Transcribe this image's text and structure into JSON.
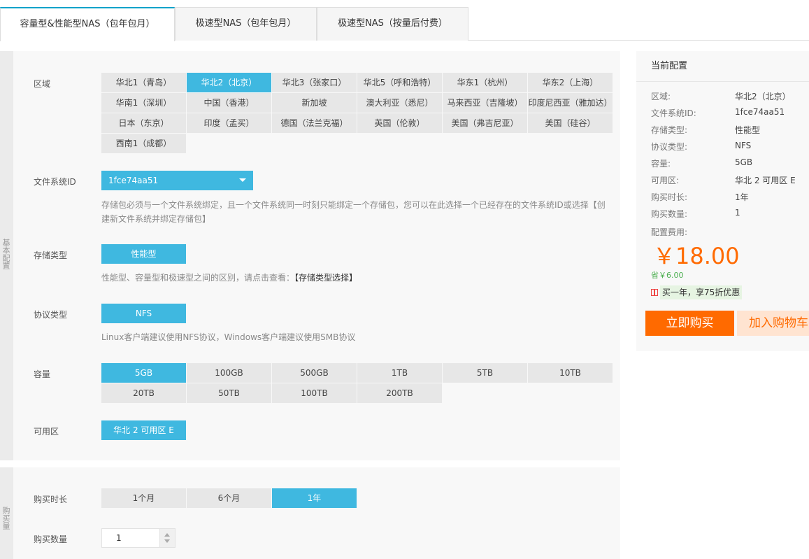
{
  "tabs": [
    {
      "label": "容量型&性能型NAS（包年包月）"
    },
    {
      "label": "极速型NAS（包年包月）"
    },
    {
      "label": "极速型NAS（按量后付费）"
    }
  ],
  "basic": {
    "section_label": "基本配置",
    "region": {
      "label": "区域",
      "selected": "华北2（北京）",
      "options": [
        "华北1（青岛）",
        "华北2（北京）",
        "华北3（张家口）",
        "华北5（呼和浩特）",
        "华东1（杭州）",
        "华东2（上海）",
        "华南1（深圳）",
        "中国（香港）",
        "新加坡",
        "澳大利亚（悉尼）",
        "马来西亚（吉隆坡）",
        "印度尼西亚（雅加达）",
        "日本（东京）",
        "印度（孟买）",
        "德国（法兰克福）",
        "英国（伦敦）",
        "美国（弗吉尼亚）",
        "美国（硅谷）",
        "西南1（成都）"
      ]
    },
    "filesystem": {
      "label": "文件系统ID",
      "value": "1fce74aa51",
      "hint_line1": "存储包必须与一个文件系统绑定，且一个文件系统同一时刻只能绑定一个存储包，您可以在此选择一个已经存在的文件系统ID或选择【创",
      "hint_line2": "建新文件系统并绑定存储包】"
    },
    "storage_type": {
      "label": "存储类型",
      "options": [
        "性能型"
      ],
      "hint": "性能型、容量型和极速型之间的区别，请点击查看：",
      "hint_link": "【存储类型选择】"
    },
    "protocol": {
      "label": "协议类型",
      "options": [
        "NFS"
      ],
      "hint": "Linux客户端建议使用NFS协议，Windows客户端建议使用SMB协议"
    },
    "capacity": {
      "label": "容量",
      "selected": "5GB",
      "options": [
        "5GB",
        "100GB",
        "500GB",
        "1TB",
        "5TB",
        "10TB",
        "20TB",
        "50TB",
        "100TB",
        "200TB"
      ]
    },
    "zone": {
      "label": "可用区",
      "options": [
        "华北 2 可用区 E"
      ]
    }
  },
  "purchase": {
    "section_label": "购买量",
    "duration": {
      "label": "购买时长",
      "selected": "1年",
      "options": [
        "1个月",
        "6个月",
        "1年"
      ]
    },
    "quantity": {
      "label": "购买数量",
      "value": "1"
    }
  },
  "summary": {
    "title": "当前配置",
    "rows": [
      {
        "key": "区域:",
        "value": "华北2（北京）"
      },
      {
        "key": "文件系统ID:",
        "value": "1fce74aa51"
      },
      {
        "key": "存储类型:",
        "value": "性能型"
      },
      {
        "key": "协议类型:",
        "value": "NFS"
      },
      {
        "key": "容量:",
        "value": "5GB"
      },
      {
        "key": "可用区:",
        "value": "华北 2 可用区 E"
      },
      {
        "key": "购买时长:",
        "value": "1年"
      },
      {
        "key": "购买数量:",
        "value": "1"
      }
    ],
    "fee_label": "配置费用:",
    "price": "￥18.00",
    "saving": "省￥6.00",
    "promo": "买一年，享75折优惠",
    "buy_label": "立即购买",
    "cart_label": "加入购物车"
  },
  "colors": {
    "accent": "#3fb8e0",
    "tab_accent": "#00a2ca",
    "price": "#ff6a00",
    "buy_button": "#ff6a00",
    "cart_button_bg": "#ffe4d1"
  }
}
